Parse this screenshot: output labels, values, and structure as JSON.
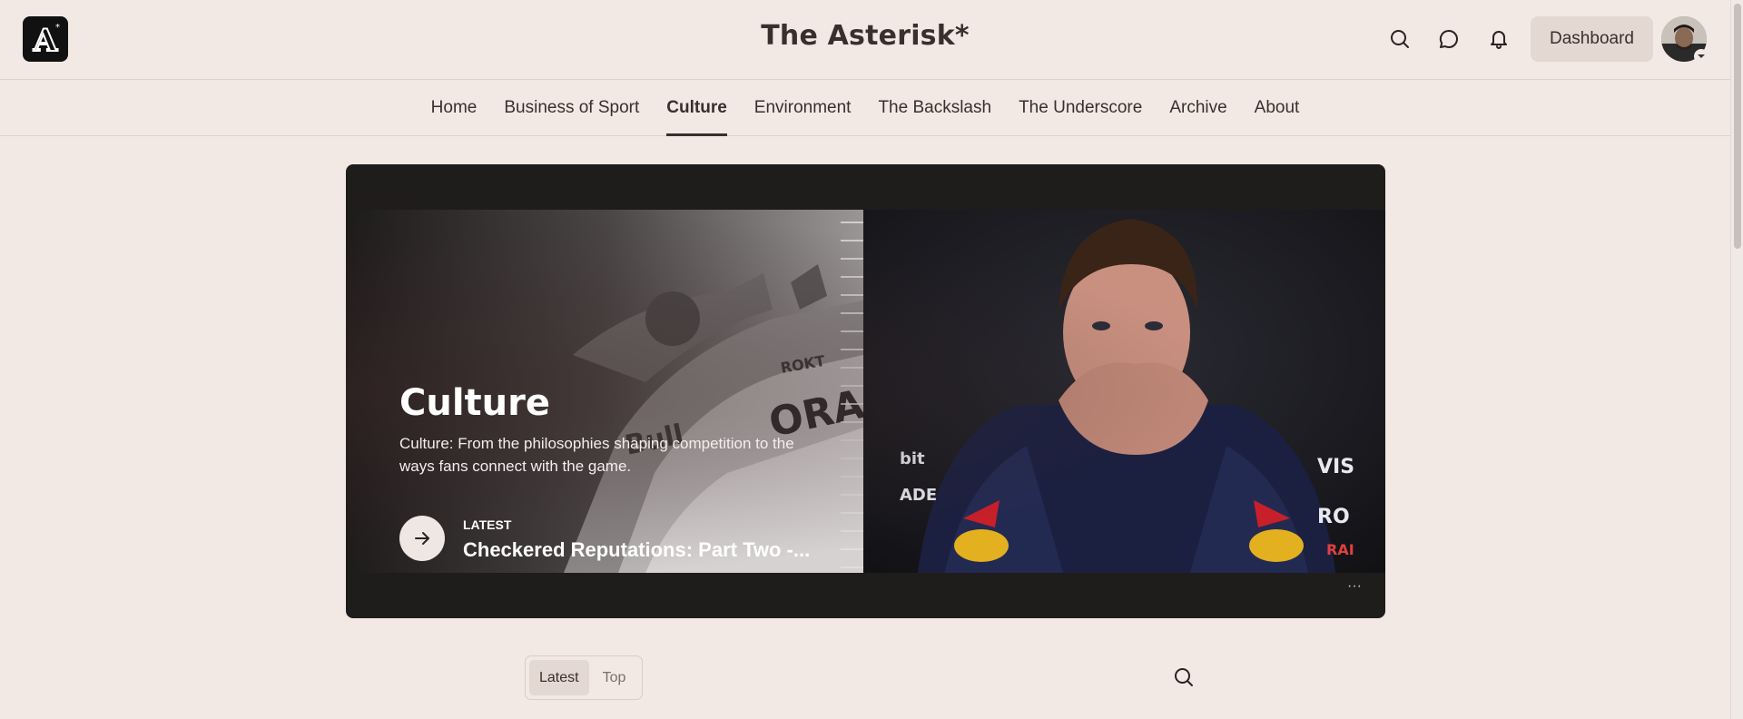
{
  "header": {
    "site_title": "The Asterisk*",
    "logo_letter": "A",
    "dashboard_label": "Dashboard",
    "icons": [
      "search-icon",
      "chat-icon",
      "bell-icon"
    ]
  },
  "nav": {
    "items": [
      {
        "label": "Home",
        "active": false
      },
      {
        "label": "Business of Sport",
        "active": false
      },
      {
        "label": "Culture",
        "active": true
      },
      {
        "label": "Environment",
        "active": false
      },
      {
        "label": "The Backslash",
        "active": false
      },
      {
        "label": "The Underscore",
        "active": false
      },
      {
        "label": "Archive",
        "active": false
      },
      {
        "label": "About",
        "active": false
      }
    ]
  },
  "hero": {
    "title": "Culture",
    "description": "Culture: From the philosophies shaping competition to the ways fans connect with the game.",
    "latest_label": "LATEST",
    "article_title": "Checkered Reputations: Part Two -...",
    "more_label": "···"
  },
  "tabs": {
    "items": [
      {
        "label": "Latest",
        "active": true
      },
      {
        "label": "Top",
        "active": false
      }
    ]
  },
  "colors": {
    "background": "#f2e9e4",
    "text": "#2b2220",
    "hero_bg": "#1f1c1c",
    "button_bg": "#e3d8d2"
  }
}
